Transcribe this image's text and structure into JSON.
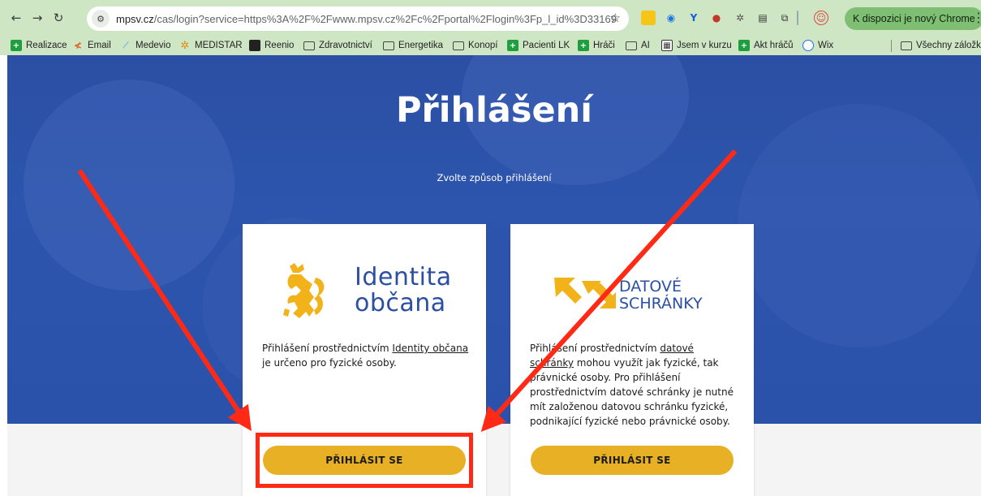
{
  "browser": {
    "back_icon": "arrow-left-icon",
    "forward_icon": "arrow-right-icon",
    "reload_icon": "reload-icon",
    "url_host": "mpsv.cz",
    "url_rest": "/cas/login?service=https%3A%2F%2Fwww.mpsv.cz%2Fc%2Fportal%2Flogin%3Fp_l_id%3D33169",
    "chrome_notice": "K dispozici je nový Chrome",
    "bookmarks": [
      {
        "label": "Realizace",
        "icon": "green-plus-icon"
      },
      {
        "label": "Email",
        "icon": "email-icon"
      },
      {
        "label": "Medevio",
        "icon": "medevio-icon"
      },
      {
        "label": "MEDISTAR",
        "icon": "medistar-icon"
      },
      {
        "label": "Reenio",
        "icon": "reenio-icon"
      },
      {
        "label": "Zdravotnictví",
        "icon": "folder-icon"
      },
      {
        "label": "Energetika",
        "icon": "folder-icon"
      },
      {
        "label": "Konopí",
        "icon": "folder-icon"
      },
      {
        "label": "Pacienti LK",
        "icon": "green-plus-icon"
      },
      {
        "label": "Hráči",
        "icon": "green-plus-icon"
      },
      {
        "label": "AI",
        "icon": "folder-icon"
      },
      {
        "label": "Jsem v kurzu",
        "icon": "course-icon"
      },
      {
        "label": "Akt hráčů",
        "icon": "green-plus-icon"
      },
      {
        "label": "Wix",
        "icon": "wix-icon"
      }
    ],
    "all_bookmarks": "Všechny záložky"
  },
  "page": {
    "title": "Přihlášení",
    "subtitle": "Zvolte způsob přihlášení",
    "card_identity": {
      "logo_line1": "Identita",
      "logo_line2": "občana",
      "text_before": "Přihlášení prostřednictvím ",
      "link": "Identity občana",
      "text_after": " je určeno pro fyzické osoby.",
      "button": "PŘIHLÁSIT SE"
    },
    "card_databox": {
      "logo_line1": "DATOVÉ",
      "logo_line2": "SCHRÁNKY",
      "text_before": "Přihlášení prostřednictvím ",
      "link": "datové schránky",
      "text_after": " mohou využít jak fyzické, tak právnické osoby. Pro přihlášení prostřednictvím datové schránky je nutné mít založenou datovou schránku fyzické, podnikající fyzické nebo právnické osoby.",
      "button": "PŘIHLÁSIT SE"
    }
  },
  "colors": {
    "hero": "#2b4fa3",
    "button": "#e8b024",
    "annotation": "#ff2a16",
    "chrome": "#cfe6c5"
  }
}
